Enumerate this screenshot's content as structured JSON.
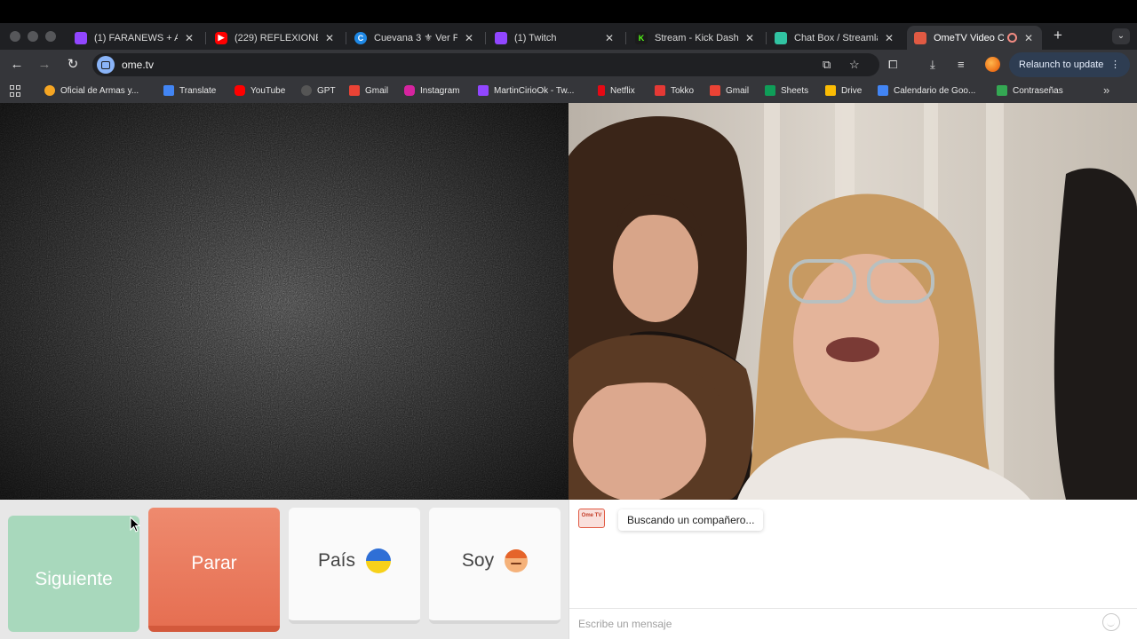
{
  "browser": {
    "tabs": [
      {
        "title": "(1) FARANEWS + Al",
        "favicon": "twitch-icon",
        "color": "#9146ff"
      },
      {
        "title": "(229) REFLEXIONE",
        "favicon": "youtube-icon",
        "color": "#ff0000"
      },
      {
        "title": "Cuevana 3 ⚜ Ver P",
        "favicon": "cuevana-icon",
        "color": "#1e88e5"
      },
      {
        "title": "(1) Twitch",
        "favicon": "twitch-icon",
        "color": "#9146ff"
      },
      {
        "title": "Stream - Kick Dash",
        "favicon": "kick-icon",
        "color": "#53fc18"
      },
      {
        "title": "Chat Box / Streamla",
        "favicon": "streamlabs-icon",
        "color": "#31c3a2"
      },
      {
        "title": "OmeTV Video C",
        "favicon": "ometv-icon",
        "color": "#e15a43"
      }
    ],
    "address": "ome.tv",
    "relaunch_label": "Relaunch to update",
    "bookmarks": [
      {
        "label": "Oficial de Armas y...",
        "color": "#f6a623"
      },
      {
        "label": "Translate",
        "color": "#4285f4"
      },
      {
        "label": "YouTube",
        "color": "#ff0000"
      },
      {
        "label": "GPT",
        "color": "#555555"
      },
      {
        "label": "Gmail",
        "color": "#ea4335"
      },
      {
        "label": "Instagram",
        "color": "#d6249f"
      },
      {
        "label": "MartinCirioOk - Tw...",
        "color": "#9146ff"
      },
      {
        "label": "Netflix",
        "color": "#e50914"
      },
      {
        "label": "Tokko",
        "color": "#e53935"
      },
      {
        "label": "Gmail",
        "color": "#ea4335"
      },
      {
        "label": "Sheets",
        "color": "#0f9d58"
      },
      {
        "label": "Drive",
        "color": "#fbbc04"
      },
      {
        "label": "Calendario de Goo...",
        "color": "#4285f4"
      },
      {
        "label": "Contraseñas",
        "color": "#34a853"
      }
    ]
  },
  "controls": {
    "next_label": "Siguiente",
    "stop_label": "Parar",
    "country_label": "País",
    "country_flag": "ukraine-flag-icon",
    "gender_label": "Soy",
    "gender_icon": "boy-emoji-icon"
  },
  "chat": {
    "logo_text": "Ome TV",
    "status_message": "Buscando un compañero...",
    "input_placeholder": "Escribe un mensaje"
  },
  "colors": {
    "next_button": "#a8d8bc",
    "stop_button": "#e66f52",
    "accent": "#e15a43"
  }
}
